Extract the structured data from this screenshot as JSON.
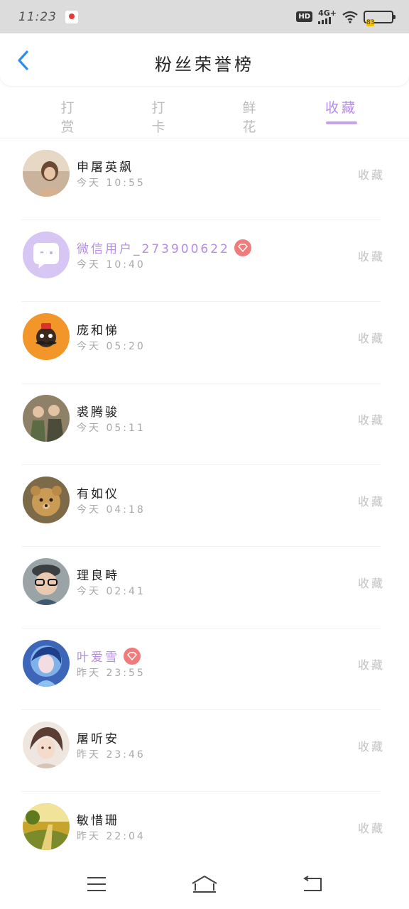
{
  "status_bar": {
    "time": "11:23",
    "hd": "HD",
    "network": "4G+",
    "battery": "83",
    "icons": [
      "notification-icon",
      "signal-icon",
      "wifi-icon",
      "battery-icon"
    ]
  },
  "header": {
    "title": "粉丝荣誉榜",
    "back_icon": "chevron-left-icon"
  },
  "tabs": [
    {
      "label": "打赏",
      "active": false
    },
    {
      "label": "打卡",
      "active": false
    },
    {
      "label": "鲜花",
      "active": false
    },
    {
      "label": "收藏",
      "active": true
    }
  ],
  "colors": {
    "accent": "#b58ce6",
    "inactive_tab": "#bdbdbd",
    "vip_badge": "#ef7b7b",
    "status_bar_bg": "#dcdcdc"
  },
  "fans": [
    {
      "name": "申屠英飙",
      "time": "今天 10:55",
      "action": "收藏",
      "vip": false,
      "avatar": "photo-avatar"
    },
    {
      "name": "微信用户_273900622",
      "time": "今天 10:40",
      "action": "收藏",
      "vip": true,
      "avatar": "wechat-default-avatar"
    },
    {
      "name": "庞和悌",
      "time": "今天 05:20",
      "action": "收藏",
      "vip": false,
      "avatar": "cartoon-avatar"
    },
    {
      "name": "裘腾骏",
      "time": "今天 05:11",
      "action": "收藏",
      "vip": false,
      "avatar": "photo-avatar"
    },
    {
      "name": "有如仪",
      "time": "今天 04:18",
      "action": "收藏",
      "vip": false,
      "avatar": "teddy-bear-avatar"
    },
    {
      "name": "理良畤",
      "time": "今天 02:41",
      "action": "收藏",
      "vip": false,
      "avatar": "child-avatar"
    },
    {
      "name": "叶爱雪",
      "time": "昨天 23:55",
      "action": "收藏",
      "vip": true,
      "avatar": "anime-avatar"
    },
    {
      "name": "屠听安",
      "time": "昨天 23:46",
      "action": "收藏",
      "vip": false,
      "avatar": "anime-avatar"
    },
    {
      "name": "敏惜珊",
      "time": "昨天 22:04",
      "action": "收藏",
      "vip": false,
      "avatar": "landscape-avatar"
    }
  ],
  "nav_bar": {
    "icons": [
      "menu-icon",
      "home-icon",
      "back-icon"
    ]
  }
}
